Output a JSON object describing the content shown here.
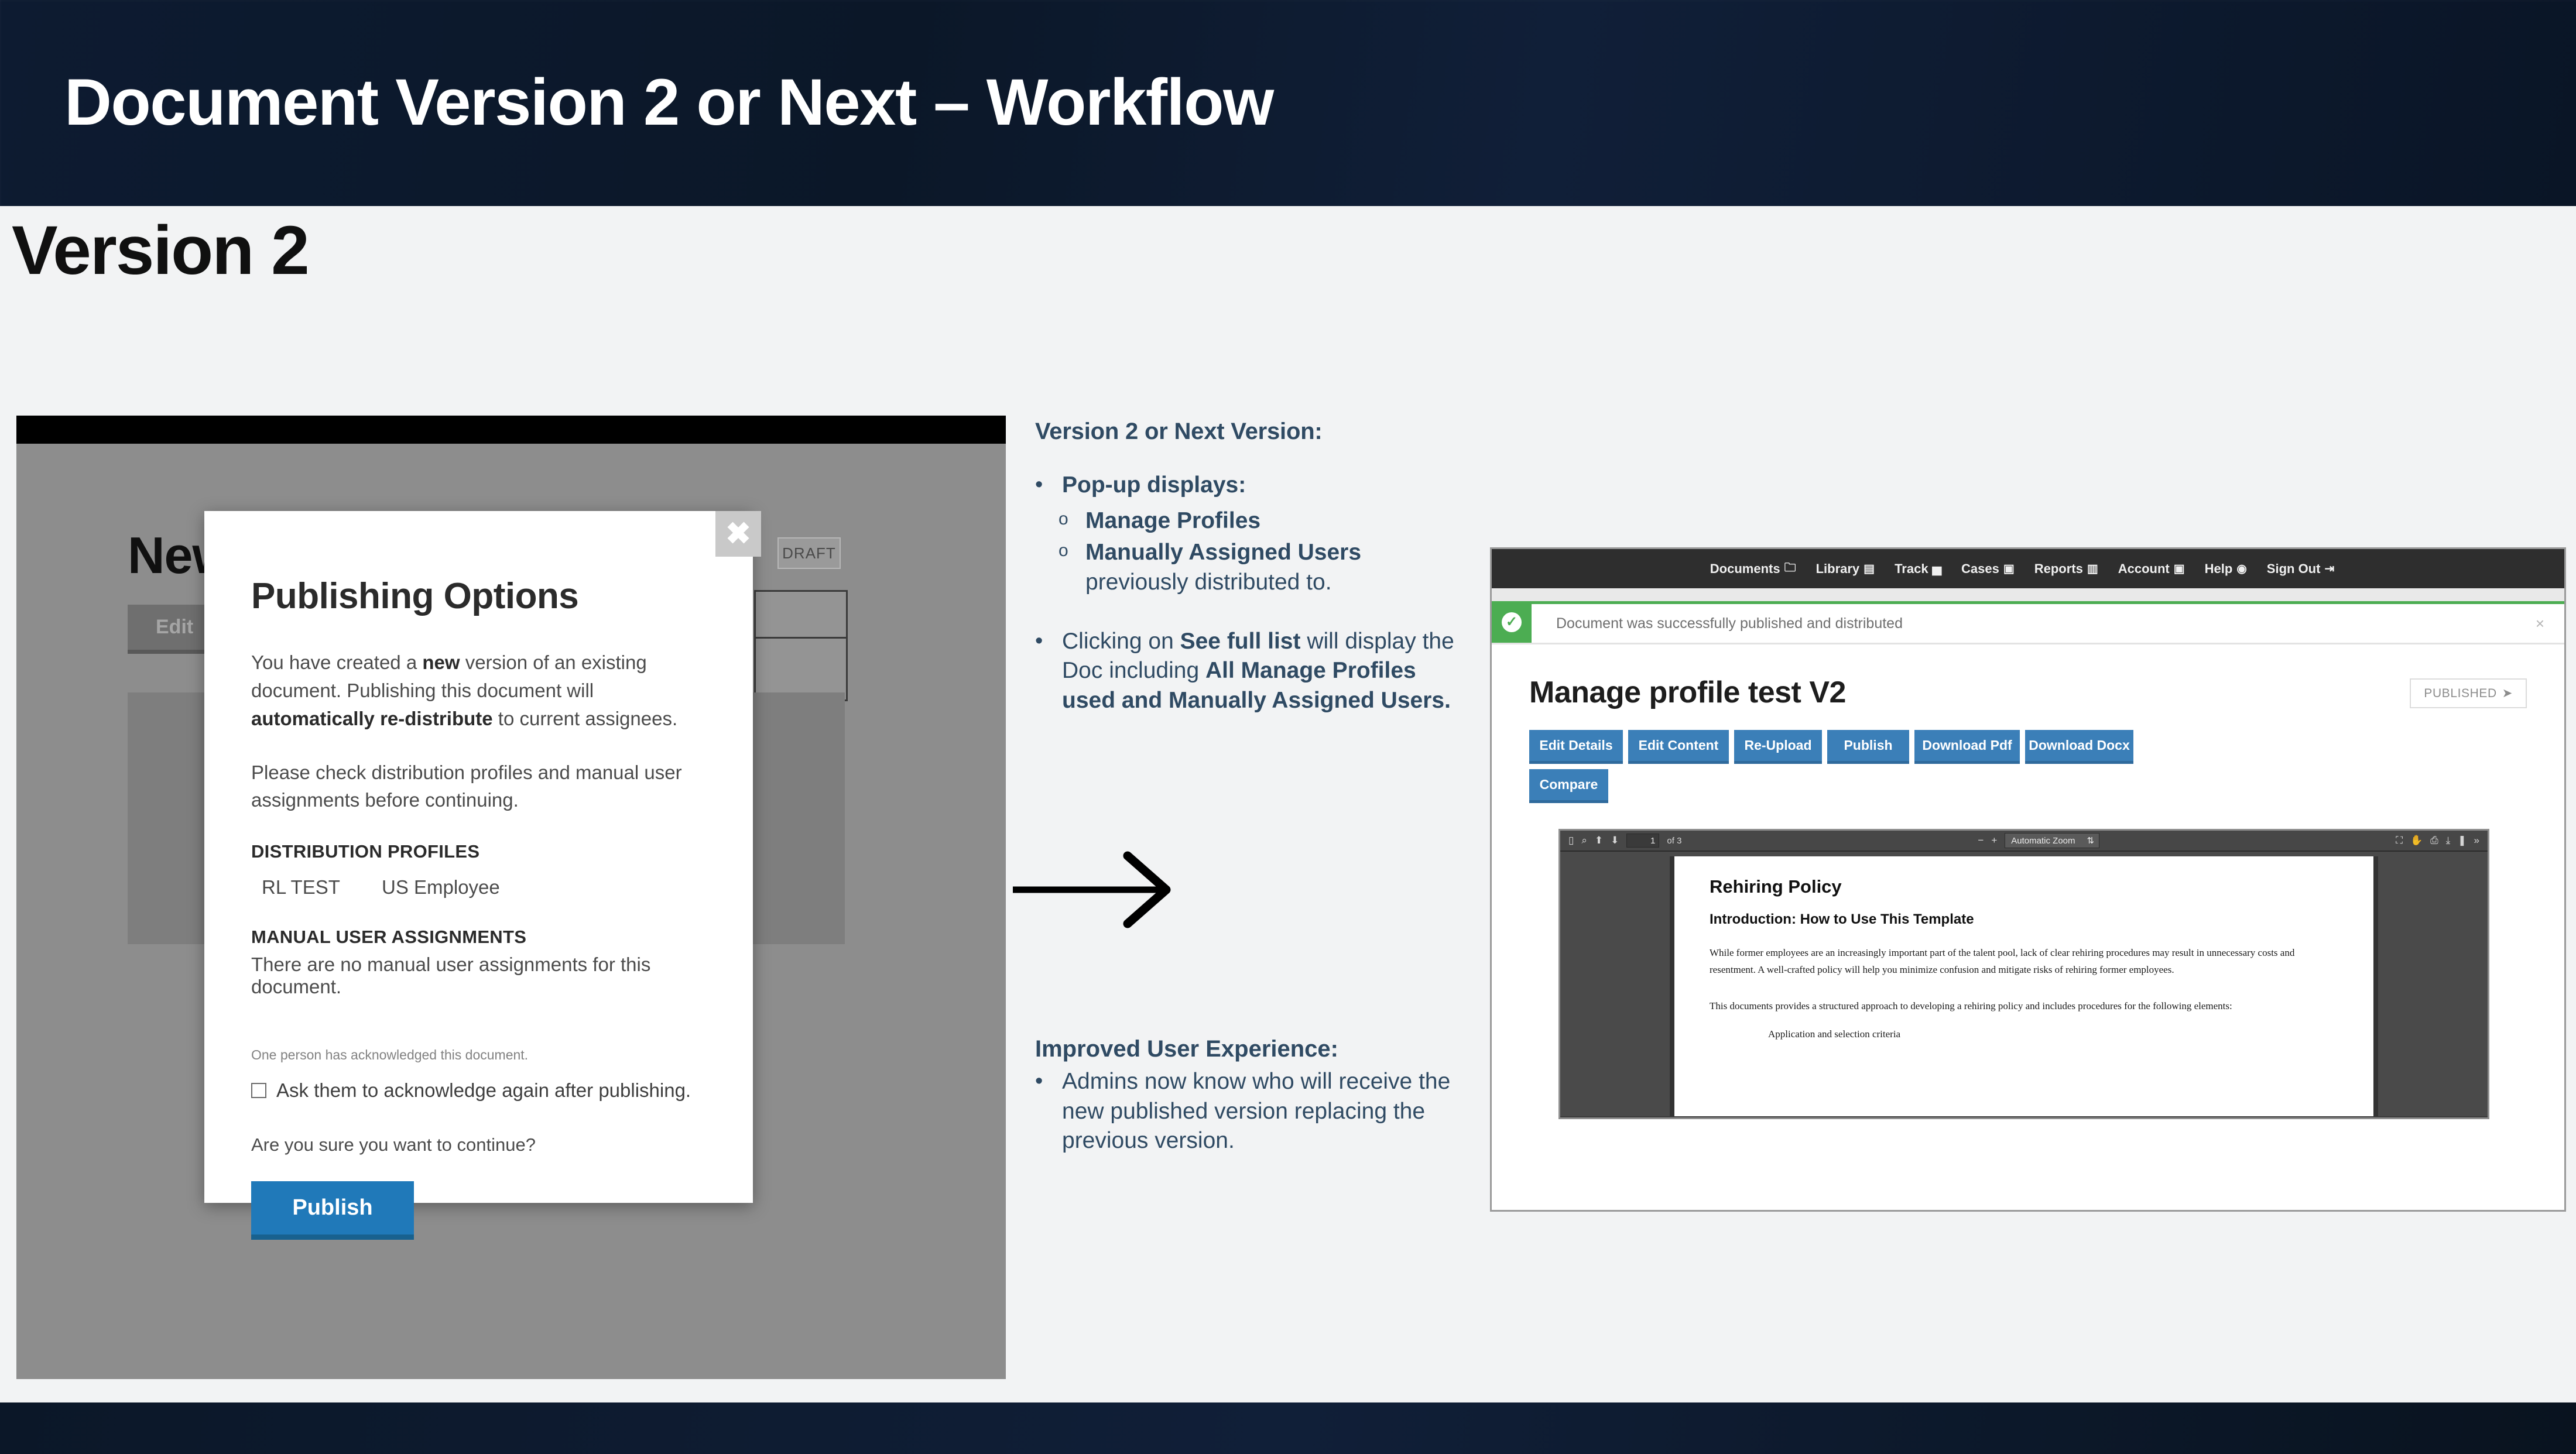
{
  "deck": {
    "title": "Document Version 2 or Next – Workflow",
    "section_title": "Version 2"
  },
  "left_screenshot": {
    "page_heading": "New",
    "status_badge": "DRAFT",
    "edit_button": "Edit",
    "modal": {
      "close_icon": "close-icon",
      "title": "Publishing Options",
      "para1_a": "You have created a ",
      "para1_bold1": "new",
      "para1_b": " version of an existing document. Publishing this document will ",
      "para1_bold2": "automatically re-distribute",
      "para1_c": " to current assignees.",
      "para2": "Please check distribution profiles and manual user assignments before continuing.",
      "section_distribution": "DISTRIBUTION PROFILES",
      "profiles": [
        "RL TEST",
        "US Employee"
      ],
      "section_manual": "MANUAL USER ASSIGNMENTS",
      "manual_note": "There are no manual user assignments for this document.",
      "ack_note": "One person has acknowledged this document.",
      "checkbox_label": "Ask them to acknowledge again after publishing.",
      "checkbox_checked": false,
      "confirm_question": "Are you sure you want to continue?",
      "publish_button": "Publish"
    }
  },
  "annotation_1": {
    "heading": "Version 2 or Next Version:",
    "bullet1": "Pop-up displays:",
    "sub1": "Manage Profiles",
    "sub2_bold": "Manually Assigned Users",
    "sub2_reg": " previously distributed to.",
    "bullet2_a": "Clicking on ",
    "bullet2_bold1": "See full list",
    "bullet2_b": " will display the Doc including ",
    "bullet2_bold2": "All Manage Profiles used and Manually Assigned Users."
  },
  "annotation_2": {
    "heading": "Improved User Experience:",
    "bullet": "Admins now know who will receive the new published version replacing the previous version."
  },
  "right_screenshot": {
    "nav_items": [
      {
        "label": "Documents",
        "icon": "folder-icon",
        "glyph": "🗀"
      },
      {
        "label": "Library",
        "icon": "book-icon",
        "glyph": "▤"
      },
      {
        "label": "Track",
        "icon": "chart-icon",
        "glyph": "▅"
      },
      {
        "label": "Cases",
        "icon": "box-icon",
        "glyph": "▣"
      },
      {
        "label": "Reports",
        "icon": "list-icon",
        "glyph": "▥"
      },
      {
        "label": "Account",
        "icon": "id-card-icon",
        "glyph": "▣"
      },
      {
        "label": "Help",
        "icon": "question-circle-icon",
        "glyph": "◉"
      },
      {
        "label": "Sign Out",
        "icon": "exit-icon",
        "glyph": "⇥"
      }
    ],
    "alert": {
      "icon": "success-check-icon",
      "message": "Document was successfully published and distributed",
      "close": "×"
    },
    "doc_title": "Manage profile test V2",
    "status_badge": "PUBLISHED",
    "status_badge_icon": "send-icon",
    "action_buttons": [
      {
        "label": "Edit Details",
        "width": 160
      },
      {
        "label": "Edit Content",
        "width": 172
      },
      {
        "label": "Re-Upload",
        "width": 150
      },
      {
        "label": "Publish",
        "width": 140
      },
      {
        "label": "Download Pdf",
        "width": 180
      },
      {
        "label": "Download Docx",
        "width": 185
      },
      {
        "label": "Compare",
        "width": 135
      }
    ],
    "pdf_viewer": {
      "sidebar_icon": "sidebar-toggle-icon",
      "search_icon": "search-icon",
      "prev_icon": "arrow-up-icon",
      "next_icon": "arrow-down-icon",
      "page_number": "1",
      "page_total": "of 3",
      "zoom_out": "−",
      "zoom_in": "+",
      "zoom_level": "Automatic Zoom",
      "zoom_caret": "⇅",
      "presentation_icon": "fullscreen-icon",
      "tools_icon": "hand-icon",
      "print_icon": "printer-icon",
      "download_icon": "download-icon",
      "bookmark_icon": "bookmark-icon",
      "more_icon": "chevrons-right-icon",
      "document": {
        "h1": "Rehiring Policy",
        "h2": "Introduction: How to Use This Template",
        "p1": "While former employees are an increasingly important part of the talent pool, lack of clear rehiring procedures may result in unnecessary costs and resentment. A well-crafted policy will help you minimize confusion and mitigate risks of rehiring former employees.",
        "p2": "This documents provides a structured approach to developing a rehiring policy and includes procedures for the following elements:",
        "li1": "Application and selection criteria"
      }
    }
  },
  "colors": {
    "navy": "#0b1728",
    "accent_blue": "#2079b9",
    "button_blue": "#3b7fb8",
    "success_green": "#4cad52",
    "annotation_text": "#2f4a63"
  }
}
